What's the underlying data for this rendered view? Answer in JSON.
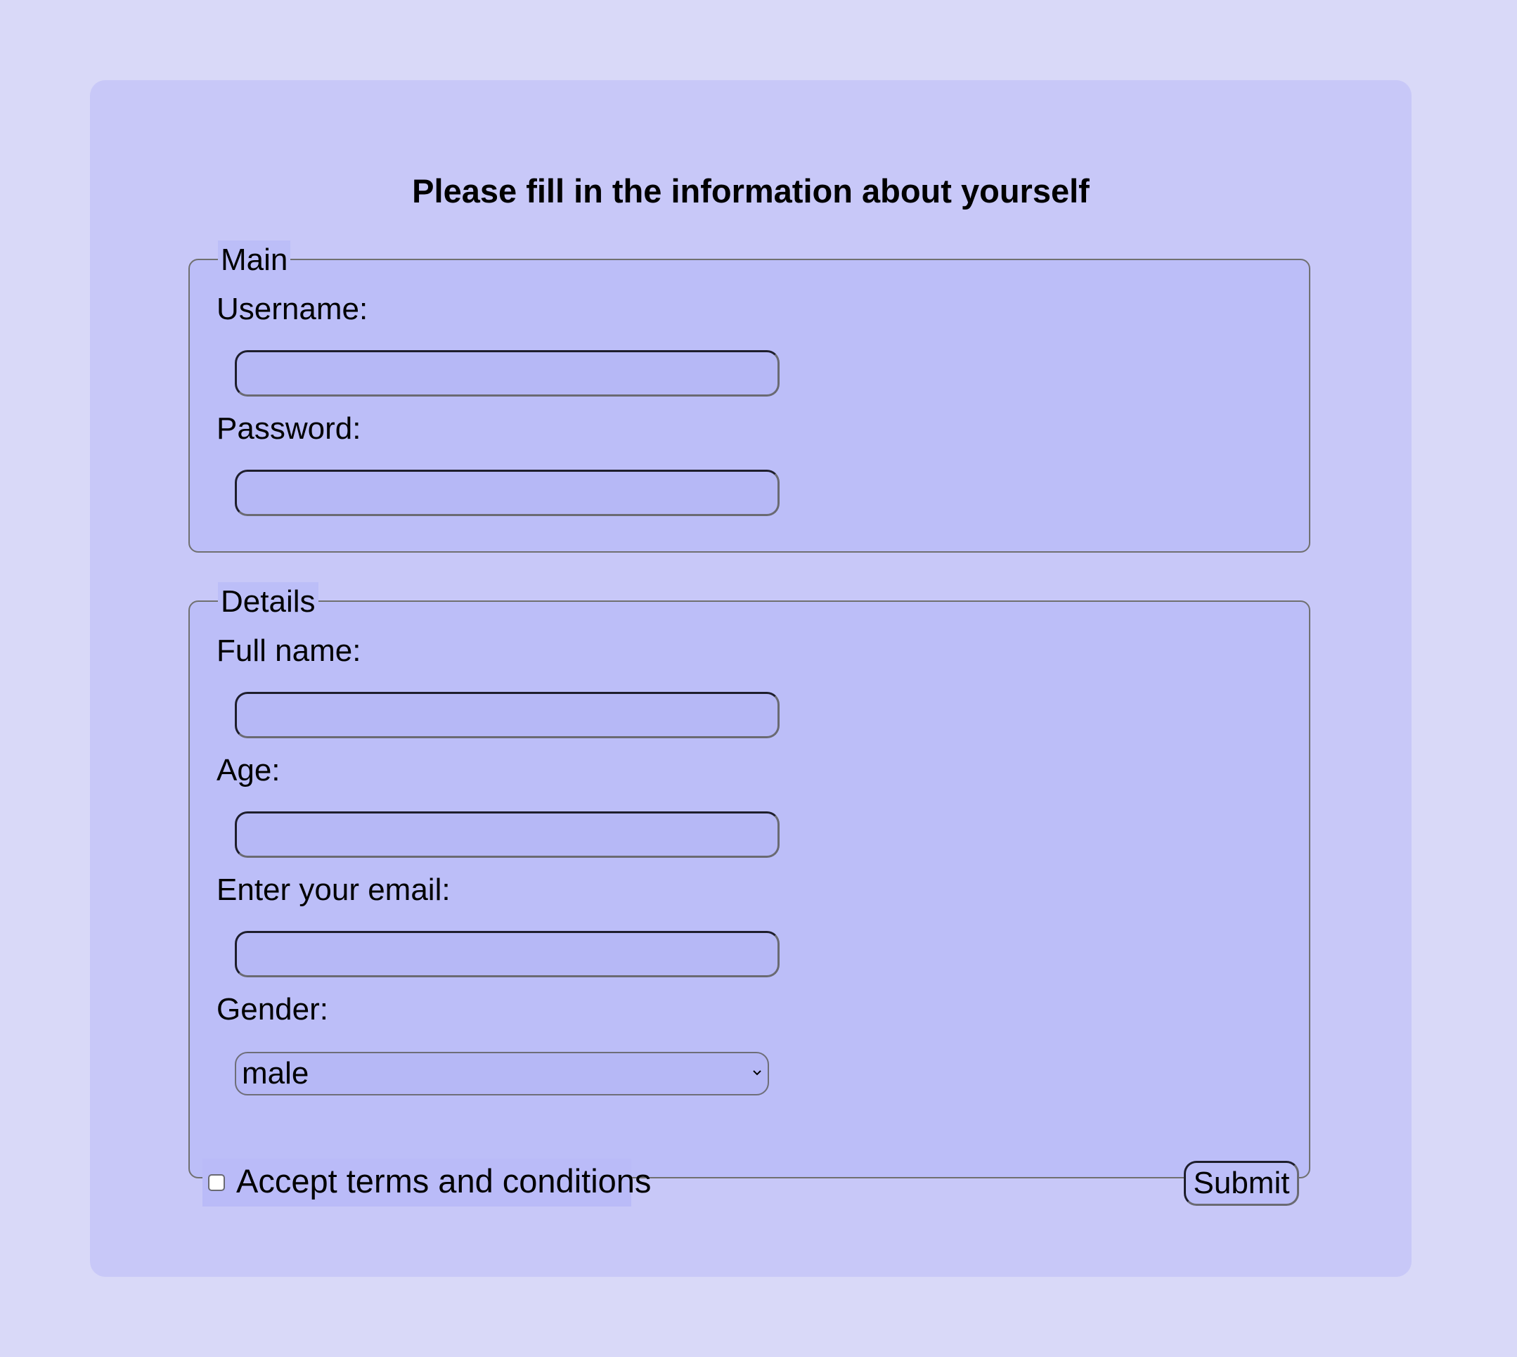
{
  "form": {
    "title": "Please fill in the information about yourself",
    "main": {
      "legend": "Main",
      "username_label": "Username:",
      "password_label": "Password:"
    },
    "details": {
      "legend": "Details",
      "fullname_label": "Full name:",
      "age_label": "Age:",
      "email_label": "Enter your email:",
      "gender_label": "Gender:",
      "gender_value": "male"
    },
    "terms_label": "Accept terms and conditions",
    "submit_label": "Submit"
  },
  "colors": {
    "page_background": "#d9d9f8",
    "card_background": "#c8c8f8",
    "fieldset_background": "#bcbef8"
  }
}
